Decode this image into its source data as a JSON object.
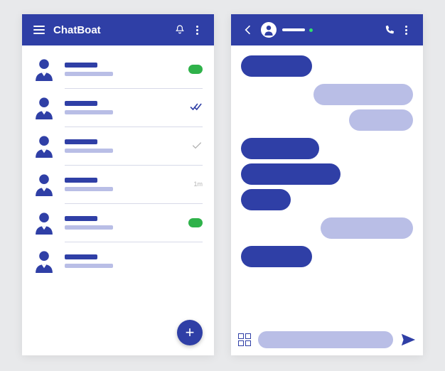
{
  "app": {
    "title": "ChatBoat"
  },
  "colors": {
    "primary": "#2f3fa6",
    "accent": "#b9bee6",
    "unread": "#2fb24a"
  },
  "contacts": [
    {
      "name": "",
      "preview": "",
      "badge_type": "unread",
      "badge_text": ""
    },
    {
      "name": "",
      "preview": "",
      "badge_type": "read_double",
      "badge_text": ""
    },
    {
      "name": "",
      "preview": "",
      "badge_type": "read_single",
      "badge_text": ""
    },
    {
      "name": "",
      "preview": "",
      "badge_type": "time",
      "badge_text": "1m"
    },
    {
      "name": "",
      "preview": "",
      "badge_type": "unread",
      "badge_text": ""
    },
    {
      "name": "",
      "preview": "",
      "badge_type": "none",
      "badge_text": ""
    }
  ],
  "chat": {
    "contact_name": "",
    "online": true,
    "messages": [
      {
        "side": "in",
        "widths": [
          100
        ]
      },
      {
        "side": "out",
        "widths": [
          140,
          90
        ]
      },
      {
        "side": "in",
        "widths": [
          110,
          140,
          70
        ]
      },
      {
        "side": "out",
        "widths": [
          130
        ]
      },
      {
        "side": "in",
        "widths": [
          100
        ]
      }
    ],
    "composer_value": ""
  }
}
